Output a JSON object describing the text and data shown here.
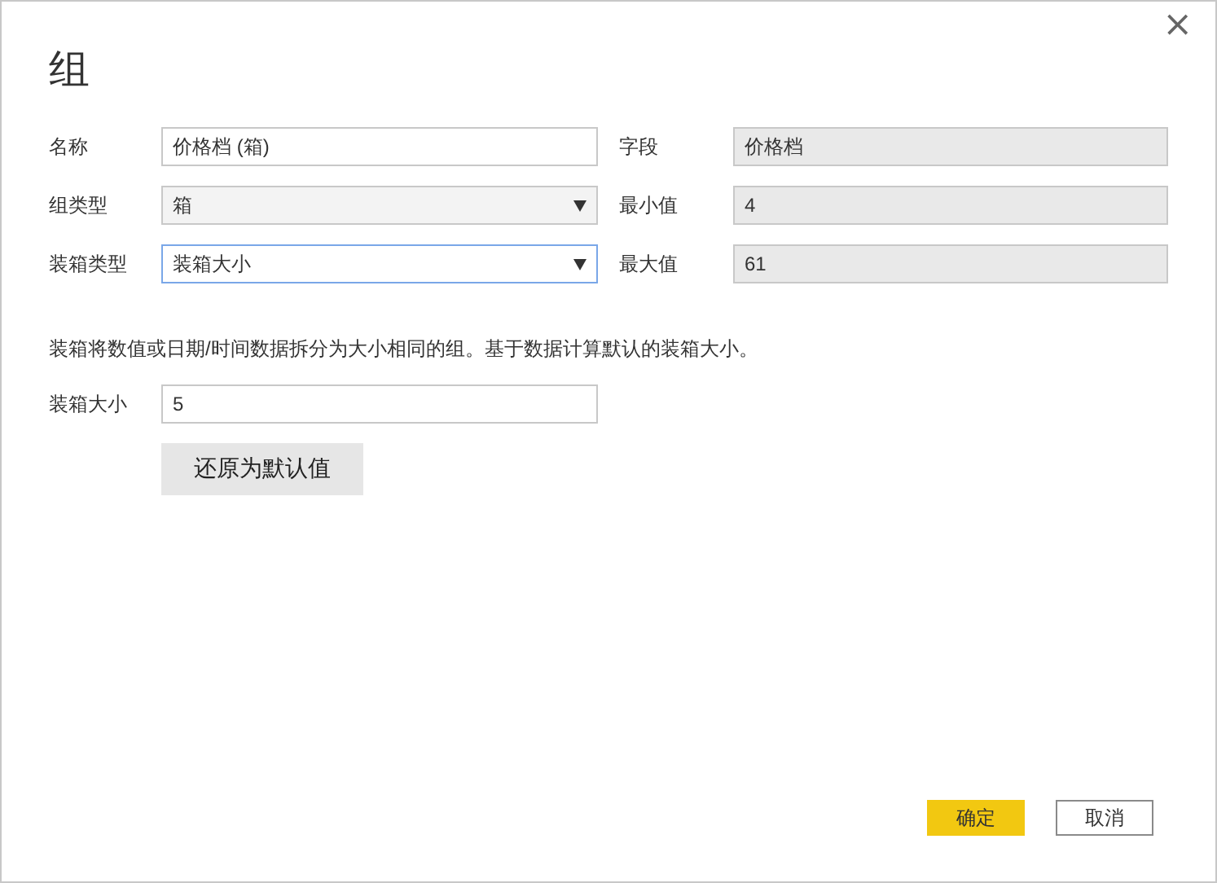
{
  "dialog": {
    "title": "组",
    "close": "×"
  },
  "rows": [
    {
      "left": {
        "label": "名称",
        "kind": "text",
        "value": "价格档 (箱)",
        "focused": false
      },
      "right": {
        "label": "字段",
        "kind": "readonly",
        "value": "价格档"
      }
    },
    {
      "left": {
        "label": "组类型",
        "kind": "select",
        "value": "箱",
        "focused": false
      },
      "right": {
        "label": "最小值",
        "kind": "readonly",
        "value": "4"
      }
    },
    {
      "left": {
        "label": "装箱类型",
        "kind": "select",
        "value": "装箱大小",
        "focused": true
      },
      "right": {
        "label": "最大值",
        "kind": "readonly",
        "value": "61"
      }
    }
  ],
  "description": "装箱将数值或日期/时间数据拆分为大小相同的组。基于数据计算默认的装箱大小。",
  "bin_size": {
    "label": "装箱大小",
    "value": "5"
  },
  "reset_button": "还原为默认值",
  "buttons": [
    {
      "label": "确定",
      "kind": "primary"
    },
    {
      "label": "取消",
      "kind": "secondary"
    }
  ]
}
